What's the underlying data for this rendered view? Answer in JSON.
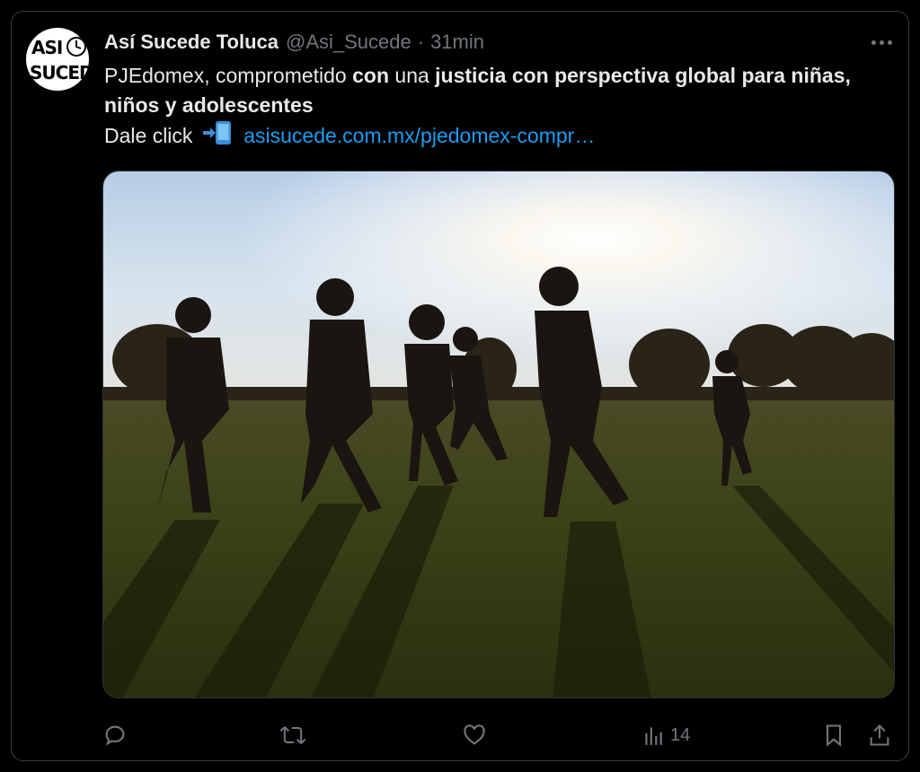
{
  "tweet": {
    "author_name": "Así Sucede Toluca",
    "handle": "@Asi_Sucede",
    "separator": "·",
    "time": "31min",
    "avatar_logo_line1": "ASI",
    "avatar_logo_line2": "SUCEDE",
    "text_parts": [
      {
        "text": "PJEdomex, comprometido ",
        "bold": false
      },
      {
        "text": "con",
        "bold": true
      },
      {
        "text": " una ",
        "bold": false
      },
      {
        "text": "justicia con perspectiva global para niñas, niños y adolescentes",
        "bold": true
      }
    ],
    "line3_prefix": "Dale click",
    "line3_emoji": "mobile-arrow-emoji",
    "link_text": "asisucede.com.mx/pjedomex-compr…",
    "media_description_icon": "photo-children-running-at-sunset"
  },
  "actions": {
    "reply_icon": "reply-icon",
    "retweet_icon": "retweet-icon",
    "like_icon": "like-icon",
    "views_icon": "views-icon",
    "views_count": "14",
    "bookmark_icon": "bookmark-icon",
    "share_icon": "share-icon"
  },
  "colors": {
    "background": "#000000",
    "text_primary": "#e7e9ea",
    "text_secondary": "#71767b",
    "link": "#1d9bf0"
  }
}
